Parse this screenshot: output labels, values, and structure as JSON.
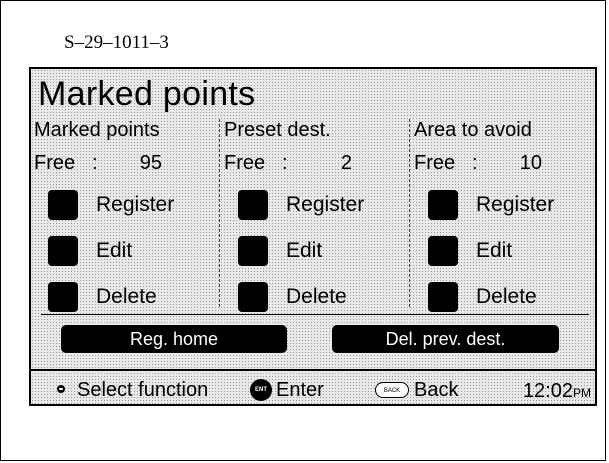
{
  "figure_id": "S–29–1011–3",
  "screen": {
    "title": "Marked points",
    "columns": [
      {
        "heading": "Marked points",
        "free_label": "Free",
        "free_colon": ":",
        "free_value": "95",
        "options": [
          "Register",
          "Edit",
          "Delete"
        ]
      },
      {
        "heading": "Preset dest.",
        "free_label": "Free",
        "free_colon": ":",
        "free_value": "2",
        "options": [
          "Register",
          "Edit",
          "Delete"
        ]
      },
      {
        "heading": "Area to avoid",
        "free_label": "Free",
        "free_colon": ":",
        "free_value": "10",
        "options": [
          "Register",
          "Edit",
          "Delete"
        ]
      }
    ],
    "buttons": {
      "reg_home": "Reg. home",
      "del_prev_dest": "Del. prev. dest."
    },
    "status_bar": {
      "select_icon": "joystick-icon",
      "select_label": "Select function",
      "enter_icon_text": "ENT",
      "enter_label": "Enter",
      "back_icon_text": "BACK",
      "back_label": "Back",
      "clock_time": "12:02",
      "clock_suffix": "PM"
    }
  }
}
